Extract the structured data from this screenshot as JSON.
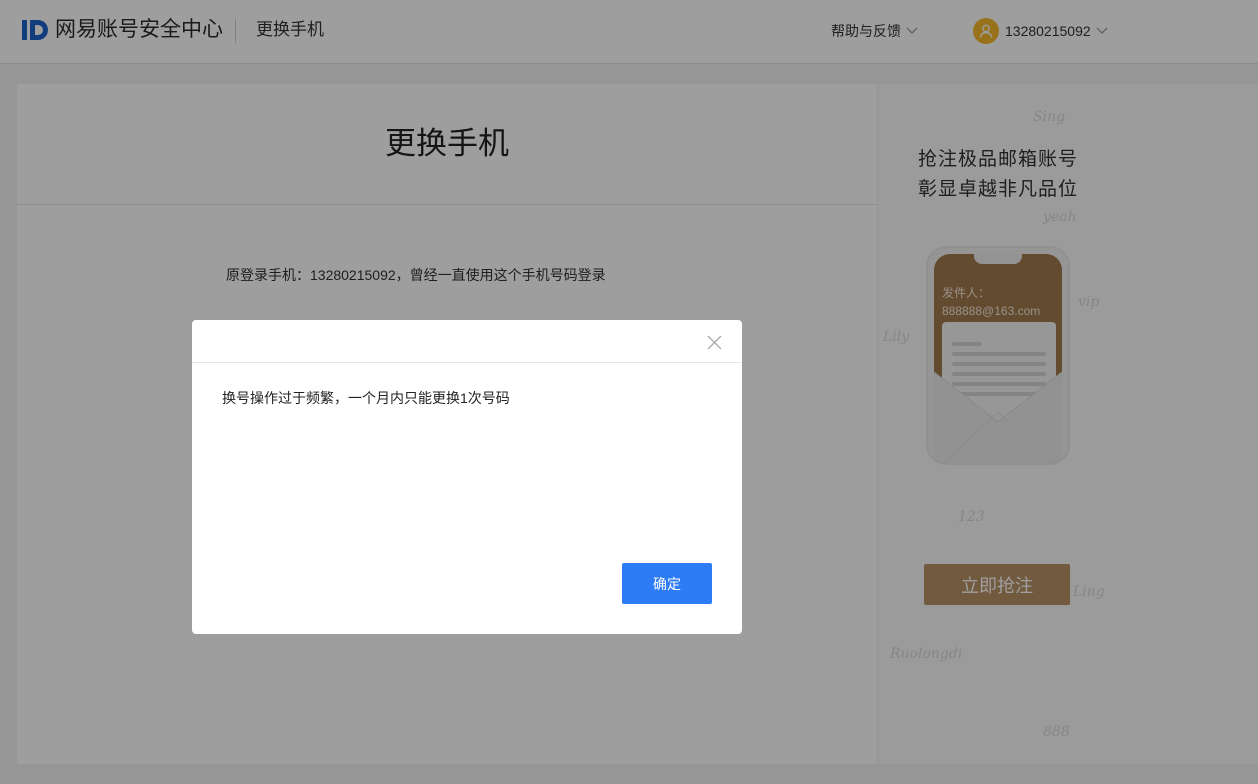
{
  "header": {
    "brand": "网易账号安全中心",
    "page_title": "更换手机",
    "help_label": "帮助与反馈",
    "username": "13280215092",
    "icons": [
      "logo-id-icon",
      "chevron-down-icon",
      "user-avatar-icon"
    ]
  },
  "card": {
    "title": "更换手机",
    "info": "原登录手机：13280215092，曾经一直使用这个手机号码登录"
  },
  "ad": {
    "title_line1": "抢注极品邮箱账号",
    "title_line2": "彰显卓越非凡品位",
    "sender_label": "发件人：",
    "sender_email": "888888@163.com",
    "button_label": "立即抢注",
    "accent_color": "#b89165"
  },
  "dialog": {
    "message": "换号操作过于频繁，一个月内只能更换1次号码",
    "confirm_label": "确定",
    "confirm_color": "#2e7bf6"
  }
}
